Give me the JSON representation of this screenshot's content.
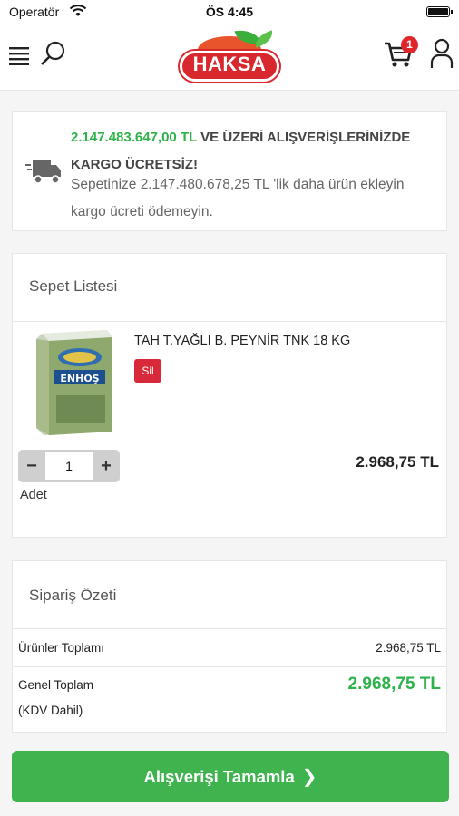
{
  "statusbar": {
    "carrier": "Operatör",
    "time": "ÖS 4:45"
  },
  "header": {
    "logo_text": "HAKSA",
    "cart_count": "1"
  },
  "shipping": {
    "threshold": "2.147.483.647,00 TL",
    "message": "VE ÜZERİ ALIŞVERİŞLERİNİZDE KARGO ÜCRETSİZ!",
    "remaining": "Sepetinize 2.147.480.678,25 TL 'lik daha ürün ekleyin kargo ücreti ödemeyin."
  },
  "basket": {
    "title": "Sepet Listesi",
    "items": [
      {
        "name": "TAH T.YAĞLI B. PEYNİR TNK 18 KG",
        "delete_label": "Sil",
        "image_text": "ENHOŞ",
        "quantity": "1",
        "quantity_label": "Adet",
        "price": "2.968,75 TL"
      }
    ]
  },
  "summary": {
    "title": "Sipariş Özeti",
    "subtotal_label": "Ürünler Toplamı",
    "subtotal_value": "2.968,75 TL",
    "total_label": "Genel Toplam",
    "total_note": "(KDV Dahil)",
    "total_value": "2.968,75 TL"
  },
  "checkout": {
    "label": "Alışverişi Tamamla"
  },
  "colors": {
    "accent_green": "#2eb24a",
    "brand_red": "#d8272d",
    "button_green": "#3eb34e"
  }
}
